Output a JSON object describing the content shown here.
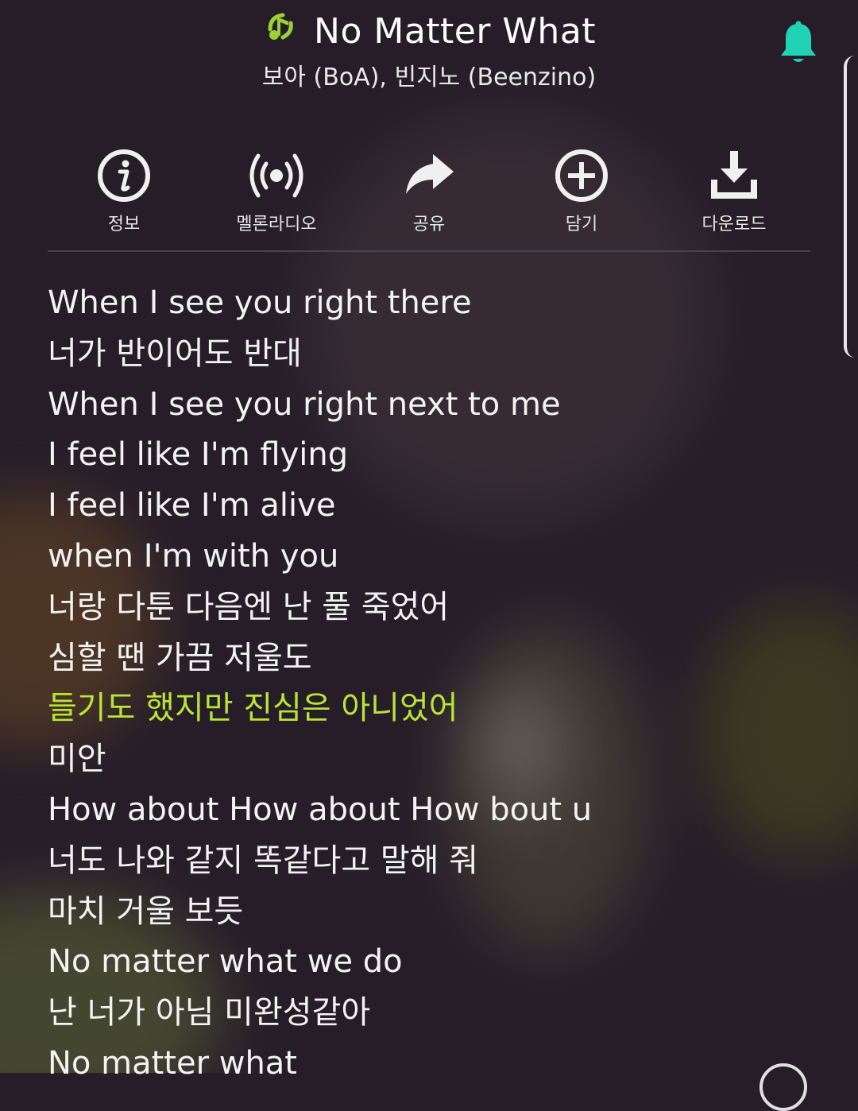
{
  "colors": {
    "accent_green": "#b7e636",
    "bell_teal": "#1fd3b4",
    "background": "#261d29"
  },
  "header": {
    "note_icon": "music-note-icon",
    "song_title": "No Matter What",
    "artist": "보아 (BoA), 빈지노 (Beenzino)",
    "bell_icon": "notification-bell-icon"
  },
  "actions": [
    {
      "icon": "info-icon",
      "label": "정보"
    },
    {
      "icon": "radio-icon",
      "label": "멜론라디오"
    },
    {
      "icon": "share-icon",
      "label": "공유"
    },
    {
      "icon": "add-circle-icon",
      "label": "담기"
    },
    {
      "icon": "download-icon",
      "label": "다운로드"
    }
  ],
  "lyrics": {
    "current_line_index": 8,
    "lines": [
      "When I see you right there",
      "너가 반이어도 반대",
      "When I see you right next to me",
      "I feel like I'm flying",
      "I feel like I'm alive",
      "when I'm with you",
      "너랑 다툰 다음엔 난 풀 죽었어",
      "심할 땐 가끔 저울도",
      "들기도 했지만 진심은 아니었어",
      "미안",
      "How about How about How bout u",
      "너도 나와 같지 똑같다고 말해 줘",
      "마치 거울 보듯",
      "No matter what we do",
      "난 너가 아님 미완성같아",
      "No matter what"
    ]
  }
}
